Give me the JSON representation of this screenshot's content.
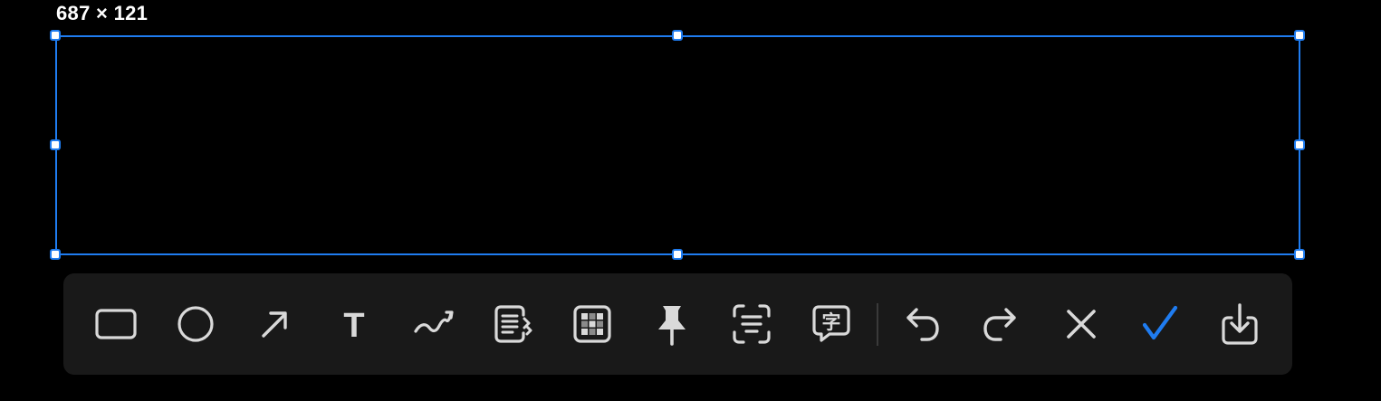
{
  "selection": {
    "size_label": "687 × 121"
  },
  "colors": {
    "accent": "#1f7cf0",
    "icon": "#d9d9d9",
    "toolbar_bg": "#191919"
  },
  "toolbar": {
    "tools": [
      {
        "name": "rectangle-tool",
        "icon": "rectangle-icon"
      },
      {
        "name": "ellipse-tool",
        "icon": "circle-icon"
      },
      {
        "name": "arrow-tool",
        "icon": "arrow-icon"
      },
      {
        "name": "text-tool",
        "icon": "text-icon",
        "glyph": "T"
      },
      {
        "name": "pen-tool",
        "icon": "freehand-icon"
      },
      {
        "name": "scroll-capture-tool",
        "icon": "scroll-capture-icon"
      },
      {
        "name": "mosaic-tool",
        "icon": "mosaic-icon"
      },
      {
        "name": "pin-tool",
        "icon": "pin-icon"
      },
      {
        "name": "ocr-tool",
        "icon": "ocr-icon"
      },
      {
        "name": "translate-tool",
        "icon": "translate-icon",
        "glyph": "字"
      },
      {
        "name": "undo-button",
        "icon": "undo-icon"
      },
      {
        "name": "redo-button",
        "icon": "redo-icon"
      },
      {
        "name": "cancel-button",
        "icon": "close-icon"
      },
      {
        "name": "confirm-button",
        "icon": "checkmark-icon"
      },
      {
        "name": "save-button",
        "icon": "download-icon"
      }
    ]
  }
}
